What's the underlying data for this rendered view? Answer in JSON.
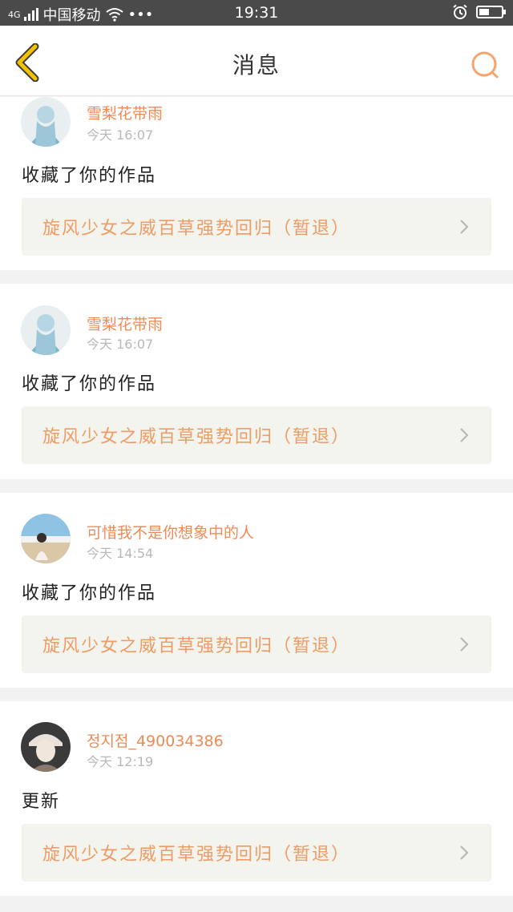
{
  "status_bar": {
    "network": "4G",
    "carrier": "中国移动",
    "dots": "•••",
    "time": "19:31"
  },
  "header": {
    "title": "消息"
  },
  "messages": [
    {
      "user": "雪梨花带雨",
      "time": "今天 16:07",
      "action": "收藏了你的作品",
      "work_title": "旋风少女之威百草强势回归（暂退）",
      "avatar_colors": [
        "#b7d6e4",
        "#7fb3c9",
        "#e9eef0"
      ]
    },
    {
      "user": "雪梨花带雨",
      "time": "今天 16:07",
      "action": "收藏了你的作品",
      "work_title": "旋风少女之威百草强势回归（暂退）",
      "avatar_colors": [
        "#b7d6e4",
        "#7fb3c9",
        "#e9eef0"
      ]
    },
    {
      "user": "可惜我不是你想象中的人",
      "time": "今天 14:54",
      "action": "收藏了你的作品",
      "work_title": "旋风少女之威百草强势回归（暂退）",
      "avatar_colors": [
        "#8fc3e3",
        "#d9c7a6",
        "#f2f2f2"
      ]
    },
    {
      "user": "정지점_490034386",
      "time": "今天 12:19",
      "action": "更新",
      "work_title": "旋风少女之威百草强势回归（暂退）",
      "avatar_colors": [
        "#3a3a3a",
        "#e8e2da",
        "#8a7a6c"
      ]
    }
  ],
  "colors": {
    "accent": "#f08a55",
    "back_icon": "#f2c200",
    "search_icon": "#f5a56e"
  }
}
